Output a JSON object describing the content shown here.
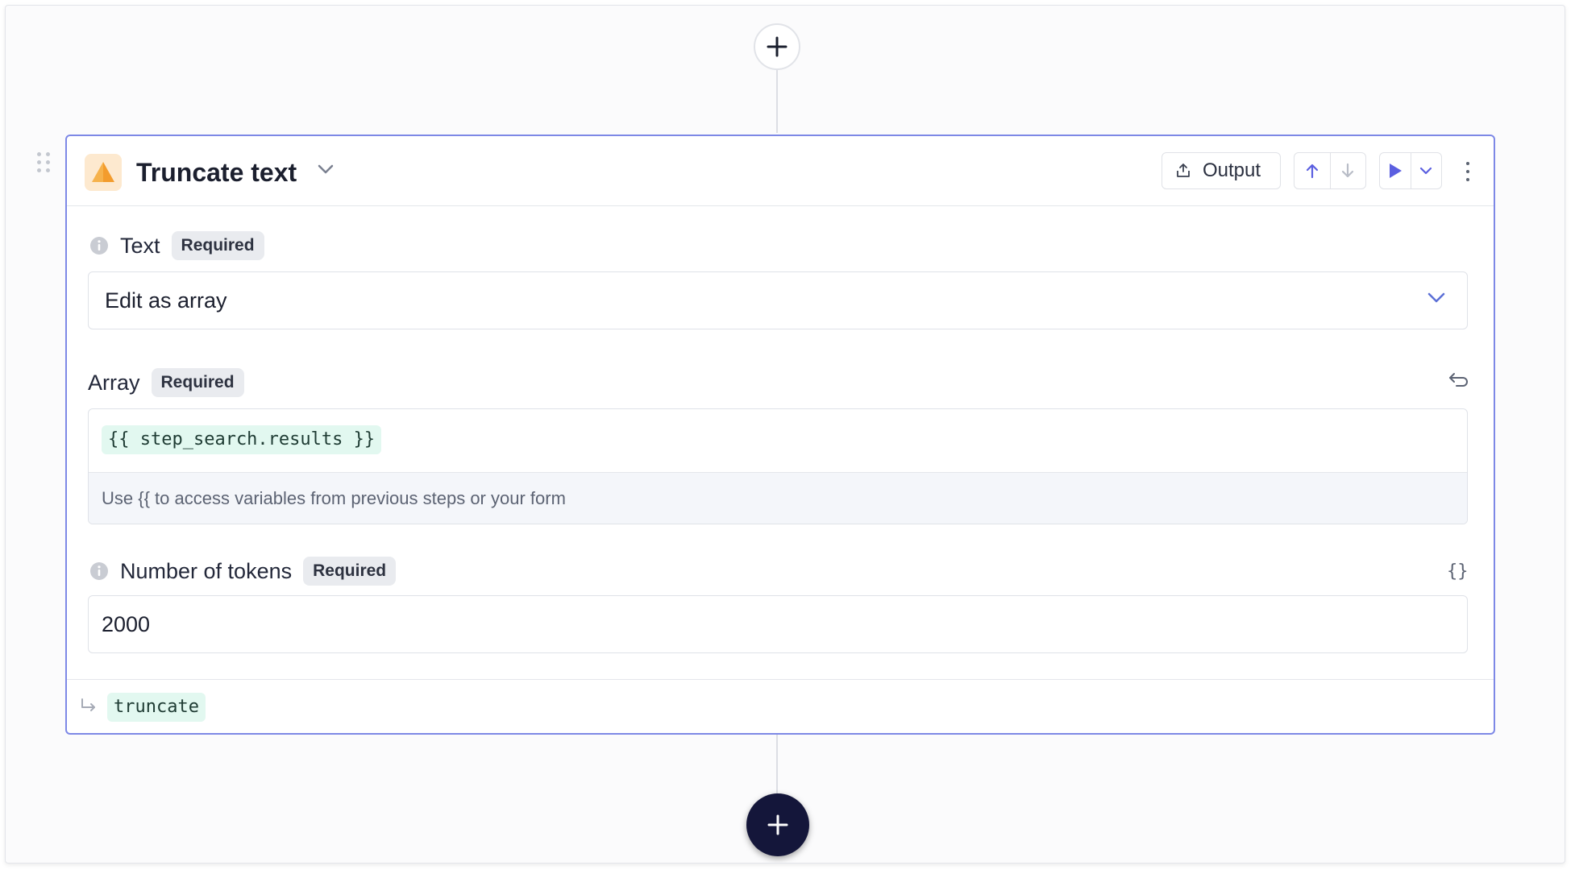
{
  "step": {
    "title": "Truncate text",
    "icon": "pyramid-icon",
    "output_label": "Output"
  },
  "fields": {
    "text": {
      "label": "Text",
      "badge": "Required",
      "value": "Edit as array"
    },
    "array": {
      "label": "Array",
      "badge": "Required",
      "value": "{{ step_search.results }}",
      "hint": "Use {{ to access variables from previous steps or your form"
    },
    "tokens": {
      "label": "Number of tokens",
      "badge": "Required",
      "value": "2000",
      "braces": "{}"
    }
  },
  "output_variable": "truncate",
  "colors": {
    "card_border": "#7d88e6",
    "run_accent": "#5b5fe0",
    "add_button_dark": "#14163a",
    "chip_bg": "#e2f8f0",
    "step_icon_orange": "#f39c2d"
  }
}
